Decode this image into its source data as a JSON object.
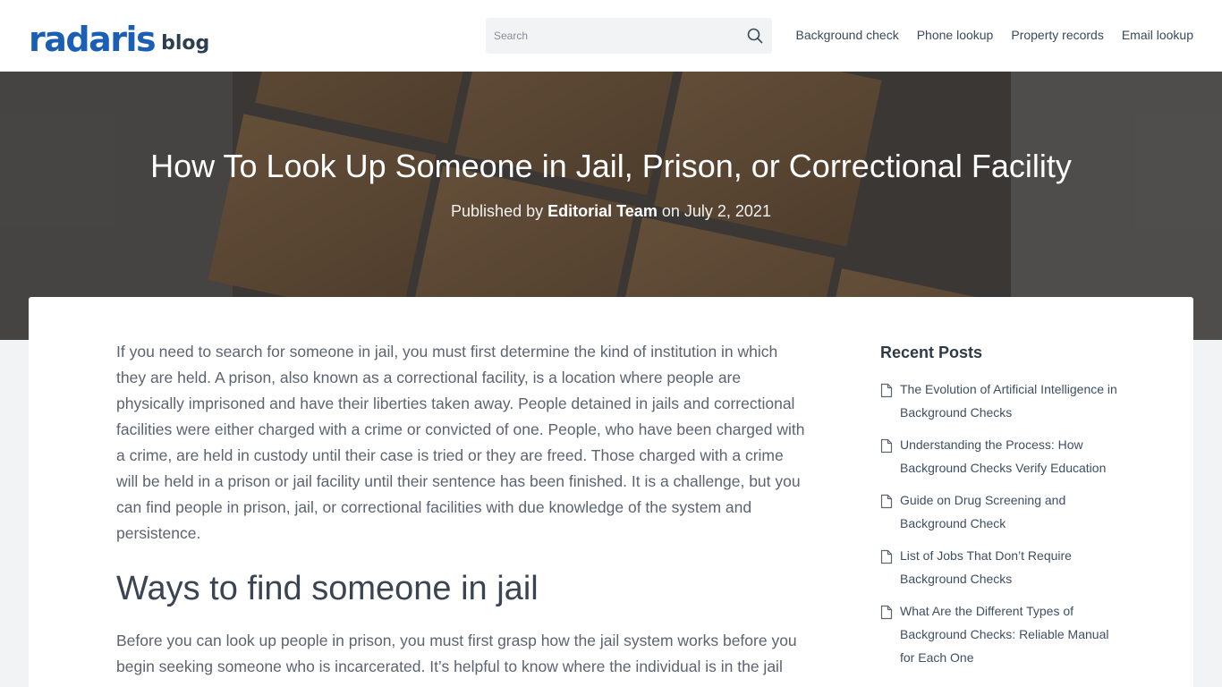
{
  "header": {
    "logo_main": "radaris",
    "logo_sub": "blog",
    "search_placeholder": "Search",
    "nav": [
      {
        "label": "Background check"
      },
      {
        "label": "Phone lookup"
      },
      {
        "label": "Property records"
      },
      {
        "label": "Email lookup"
      }
    ]
  },
  "hero": {
    "title": "How To Look Up Someone in Jail, Prison, or Correctional Facility",
    "published_prefix": "Published by",
    "author": "Editorial Team",
    "date_prefix": "on",
    "date": "July 2, 2021"
  },
  "article": {
    "intro": "If you need to search for someone in jail, you must first determine the kind of institution in which they are held. A prison, also known as a correctional facility, is a location where people are physically imprisoned and have their liberties taken away. People detained in jails and correctional facilities were either charged with a crime or convicted of one. People, who have been charged with a crime, are held in custody until their case is tried or they are freed. Those charged with a crime will be held in a prison or jail facility until their sentence has been finished. It is a challenge, but you can find people in prison, jail, or correctional facilities with due knowledge of the system and persistence.",
    "heading": "Ways to find someone in jail",
    "para2": "Before you can look up people in prison, you must first grasp how the jail system works before you begin seeking someone who is incarcerated. It’s helpful to know where the individual is in the jail"
  },
  "sidebar": {
    "title": "Recent Posts",
    "posts": [
      {
        "label": "The Evolution of Artificial Intelligence in Background Checks"
      },
      {
        "label": "Understanding the Process: How Background Checks Verify Education"
      },
      {
        "label": "Guide on Drug Screening and Background Check"
      },
      {
        "label": "List of Jobs That Don’t Require Background Checks"
      },
      {
        "label": "What Are the Different Types of Background Checks: Reliable Manual for Each One"
      }
    ]
  },
  "colors": {
    "brand": "#1a5fb4",
    "text": "#5b6470",
    "heading": "#3a4452"
  },
  "icons": [
    "search-icon",
    "document-icon"
  ]
}
